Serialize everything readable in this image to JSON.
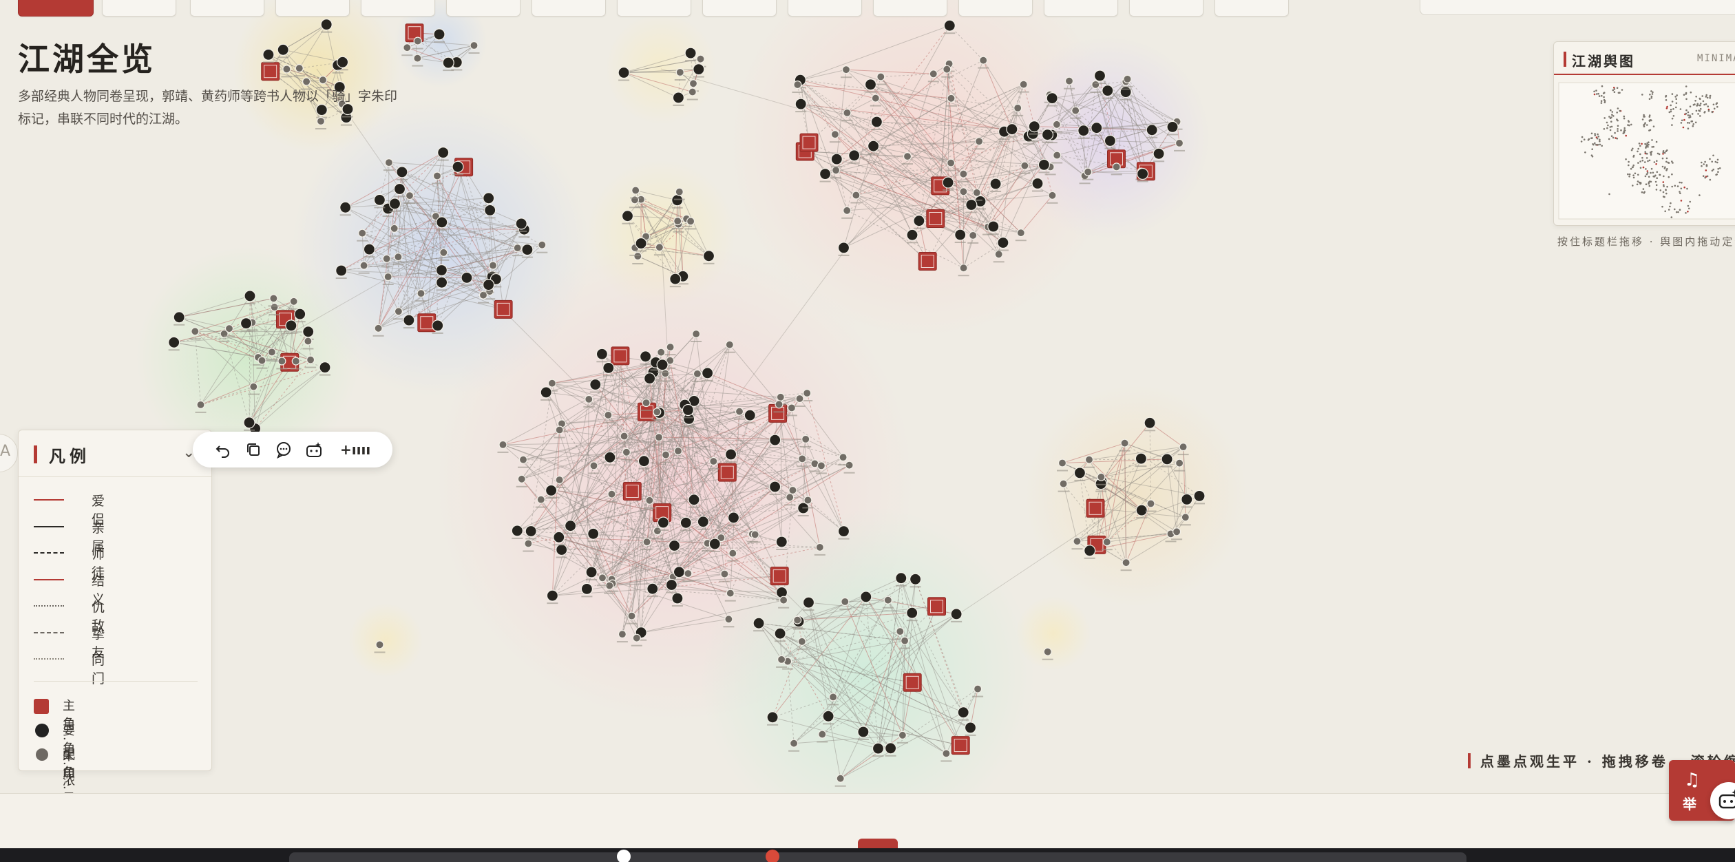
{
  "header": {
    "title": "江湖全览",
    "description": "多部经典人物同卷呈现，郭靖、黄药师等跨书人物以「骑」字朱印标记，串联不同时代的江湖。"
  },
  "minimap": {
    "title": "江湖舆图",
    "subtitle": "MINIMAP",
    "hint": "按住标题栏拖移 · 舆图内拖动定位"
  },
  "legend": {
    "title": "凡例",
    "chevron": "⌄",
    "relations": [
      {
        "label": "爱侣",
        "color": "#b43a34",
        "style": "solid"
      },
      {
        "label": "亲属",
        "color": "#2b2926",
        "style": "solid"
      },
      {
        "label": "师徒",
        "color": "#2b2926",
        "style": "dashed"
      },
      {
        "label": "结义",
        "color": "#b43a34",
        "style": "solid"
      },
      {
        "label": "仇敌",
        "color": "#6e6963",
        "style": "dotted"
      },
      {
        "label": "挚友",
        "color": "#6e6963",
        "style": "longdash"
      },
      {
        "label": "同门",
        "color": "#8d877d",
        "style": "dotted"
      }
    ],
    "roles": [
      {
        "label": "主角 · 朱印",
        "kind": "square"
      },
      {
        "label": "要角 · 浓墨",
        "kind": "dark"
      },
      {
        "label": "配角 · 淡墨",
        "kind": "light"
      }
    ]
  },
  "toolbar": {
    "buttons": [
      "undo-icon",
      "copy-icon",
      "comment-icon",
      "ai-icon",
      "zoom-icon"
    ],
    "zoom_label": "+ıııı"
  },
  "left_circle_letter": "A",
  "bottom_hint": "点墨点观生平 · 拖拽移卷 · 滚轮缩放",
  "seal_button": {
    "label": "举",
    "icon": "music-note-icon"
  },
  "colors": {
    "seal": "#b43a34",
    "ink_dark": "#222222",
    "ink_light": "#6e6963",
    "paper": "#efece4"
  }
}
